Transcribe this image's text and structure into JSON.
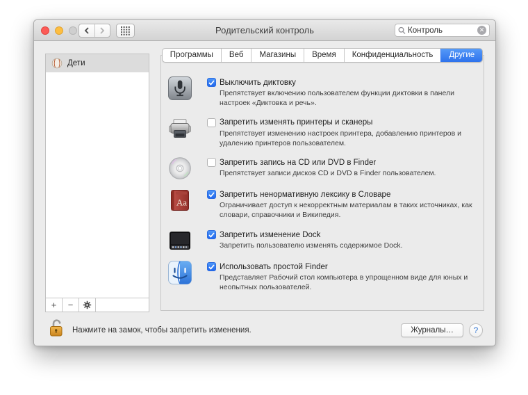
{
  "titlebar": {
    "title": "Родительский контроль",
    "search_value": "Контроль"
  },
  "tabs": [
    {
      "label": "Программы",
      "selected": false
    },
    {
      "label": "Веб",
      "selected": false
    },
    {
      "label": "Магазины",
      "selected": false
    },
    {
      "label": "Время",
      "selected": false
    },
    {
      "label": "Конфиденциальность",
      "selected": false
    },
    {
      "label": "Другие",
      "selected": true
    }
  ],
  "sidebar": {
    "items": [
      {
        "label": "Дети",
        "icon": "baseball-icon",
        "selected": true
      }
    ],
    "footer": {
      "add": "+",
      "remove": "−"
    }
  },
  "rows": [
    {
      "icon": "microphone-icon",
      "checked": true,
      "label": "Выключить диктовку",
      "description": "Препятствует включению пользователем функции диктовки в панели настроек «Диктовка и речь»."
    },
    {
      "icon": "printer-icon",
      "checked": false,
      "label": "Запретить изменять принтеры и сканеры",
      "description": "Препятствует изменению настроек принтера, добавлению принтеров и удалению принтеров пользователем."
    },
    {
      "icon": "cd-icon",
      "checked": false,
      "label": "Запретить запись на CD или DVD в Finder",
      "description": "Препятствует записи дисков CD и DVD в Finder пользователем."
    },
    {
      "icon": "dictionary-icon",
      "checked": true,
      "label": "Запретить ненормативную лексику в Словаре",
      "description": "Ограничивает доступ к некорректным материалам в таких источниках, как словари, справочники и Википедия."
    },
    {
      "icon": "dock-icon",
      "checked": true,
      "label": "Запретить изменение Dock",
      "description": "Запретить пользователю изменять содержимое Dock."
    },
    {
      "icon": "finder-icon",
      "checked": true,
      "label": "Использовать простой Finder",
      "description": "Представляет Рабочий стол компьютера в упрощенном виде для юных и неопытных пользователей."
    }
  ],
  "footer": {
    "lock_text": "Нажмите на замок, чтобы запретить изменения.",
    "logs_button": "Журналы…",
    "help_button": "?"
  },
  "colors": {
    "accent_blue": "#2e72ec",
    "checkbox_blue": "#2168ee"
  }
}
